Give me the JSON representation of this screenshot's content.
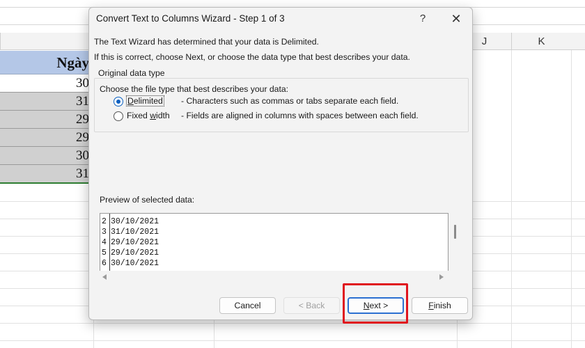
{
  "sheet": {
    "columns": [
      {
        "label": ""
      },
      {
        "label": ""
      },
      {
        "label": "J"
      },
      {
        "label": "K"
      }
    ],
    "cells": [
      {
        "text": "Ngày",
        "style": "header"
      },
      {
        "text": "30",
        "style": "white"
      },
      {
        "text": "31",
        "style": "gray"
      },
      {
        "text": "29",
        "style": "gray"
      },
      {
        "text": "29",
        "style": "gray"
      },
      {
        "text": "30",
        "style": "gray"
      },
      {
        "text": "31",
        "style": "gray"
      }
    ]
  },
  "dialog": {
    "title": "Convert Text to Columns Wizard - Step 1 of 3",
    "help_icon": "?",
    "close_icon": "✕",
    "line1": "The Text Wizard has determined that your data is Delimited.",
    "line2": "If this is correct, choose Next, or choose the data type that best describes your data.",
    "group_label": "Original data type",
    "choose_label": "Choose the file type that best describes your data:",
    "options": [
      {
        "label_pre": "",
        "label_u": "D",
        "label_post": "elimited",
        "desc": "- Characters such as commas or tabs separate each field.",
        "checked": true
      },
      {
        "label_pre": "Fixed ",
        "label_u": "w",
        "label_post": "idth",
        "desc": "- Fields are aligned in columns with spaces between each field.",
        "checked": false
      }
    ],
    "preview_label": "Preview of selected data:",
    "preview_rows": [
      {
        "num": "2",
        "value": "30/10/2021"
      },
      {
        "num": "3",
        "value": "31/10/2021"
      },
      {
        "num": "4",
        "value": "29/10/2021"
      },
      {
        "num": "5",
        "value": "29/10/2021"
      },
      {
        "num": "6",
        "value": "30/10/2021"
      }
    ],
    "buttons": {
      "cancel": "Cancel",
      "back": "< Back",
      "next_u": "N",
      "next_rest": "ext >",
      "finish_u": "F",
      "finish_rest": "inish"
    }
  },
  "colors": {
    "accent": "#0a5fbf",
    "highlight_box": "#e0141e",
    "header_fill": "#b4c7e7"
  }
}
